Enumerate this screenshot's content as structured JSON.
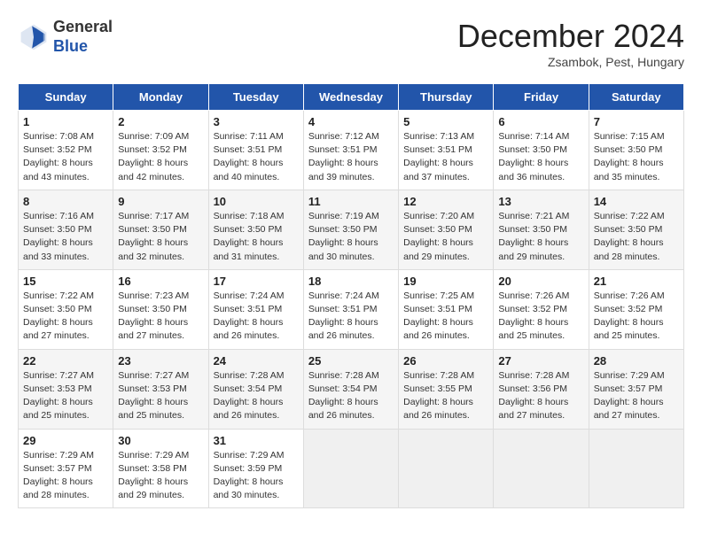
{
  "header": {
    "logo": {
      "line1": "General",
      "line2": "Blue"
    },
    "month": "December 2024",
    "location": "Zsambok, Pest, Hungary"
  },
  "weekdays": [
    "Sunday",
    "Monday",
    "Tuesday",
    "Wednesday",
    "Thursday",
    "Friday",
    "Saturday"
  ],
  "weeks": [
    [
      {
        "day": "1",
        "info": "Sunrise: 7:08 AM\nSunset: 3:52 PM\nDaylight: 8 hours\nand 43 minutes."
      },
      {
        "day": "2",
        "info": "Sunrise: 7:09 AM\nSunset: 3:52 PM\nDaylight: 8 hours\nand 42 minutes."
      },
      {
        "day": "3",
        "info": "Sunrise: 7:11 AM\nSunset: 3:51 PM\nDaylight: 8 hours\nand 40 minutes."
      },
      {
        "day": "4",
        "info": "Sunrise: 7:12 AM\nSunset: 3:51 PM\nDaylight: 8 hours\nand 39 minutes."
      },
      {
        "day": "5",
        "info": "Sunrise: 7:13 AM\nSunset: 3:51 PM\nDaylight: 8 hours\nand 37 minutes."
      },
      {
        "day": "6",
        "info": "Sunrise: 7:14 AM\nSunset: 3:50 PM\nDaylight: 8 hours\nand 36 minutes."
      },
      {
        "day": "7",
        "info": "Sunrise: 7:15 AM\nSunset: 3:50 PM\nDaylight: 8 hours\nand 35 minutes."
      }
    ],
    [
      {
        "day": "8",
        "info": "Sunrise: 7:16 AM\nSunset: 3:50 PM\nDaylight: 8 hours\nand 33 minutes."
      },
      {
        "day": "9",
        "info": "Sunrise: 7:17 AM\nSunset: 3:50 PM\nDaylight: 8 hours\nand 32 minutes."
      },
      {
        "day": "10",
        "info": "Sunrise: 7:18 AM\nSunset: 3:50 PM\nDaylight: 8 hours\nand 31 minutes."
      },
      {
        "day": "11",
        "info": "Sunrise: 7:19 AM\nSunset: 3:50 PM\nDaylight: 8 hours\nand 30 minutes."
      },
      {
        "day": "12",
        "info": "Sunrise: 7:20 AM\nSunset: 3:50 PM\nDaylight: 8 hours\nand 29 minutes."
      },
      {
        "day": "13",
        "info": "Sunrise: 7:21 AM\nSunset: 3:50 PM\nDaylight: 8 hours\nand 29 minutes."
      },
      {
        "day": "14",
        "info": "Sunrise: 7:22 AM\nSunset: 3:50 PM\nDaylight: 8 hours\nand 28 minutes."
      }
    ],
    [
      {
        "day": "15",
        "info": "Sunrise: 7:22 AM\nSunset: 3:50 PM\nDaylight: 8 hours\nand 27 minutes."
      },
      {
        "day": "16",
        "info": "Sunrise: 7:23 AM\nSunset: 3:50 PM\nDaylight: 8 hours\nand 27 minutes."
      },
      {
        "day": "17",
        "info": "Sunrise: 7:24 AM\nSunset: 3:51 PM\nDaylight: 8 hours\nand 26 minutes."
      },
      {
        "day": "18",
        "info": "Sunrise: 7:24 AM\nSunset: 3:51 PM\nDaylight: 8 hours\nand 26 minutes."
      },
      {
        "day": "19",
        "info": "Sunrise: 7:25 AM\nSunset: 3:51 PM\nDaylight: 8 hours\nand 26 minutes."
      },
      {
        "day": "20",
        "info": "Sunrise: 7:26 AM\nSunset: 3:52 PM\nDaylight: 8 hours\nand 25 minutes."
      },
      {
        "day": "21",
        "info": "Sunrise: 7:26 AM\nSunset: 3:52 PM\nDaylight: 8 hours\nand 25 minutes."
      }
    ],
    [
      {
        "day": "22",
        "info": "Sunrise: 7:27 AM\nSunset: 3:53 PM\nDaylight: 8 hours\nand 25 minutes."
      },
      {
        "day": "23",
        "info": "Sunrise: 7:27 AM\nSunset: 3:53 PM\nDaylight: 8 hours\nand 25 minutes."
      },
      {
        "day": "24",
        "info": "Sunrise: 7:28 AM\nSunset: 3:54 PM\nDaylight: 8 hours\nand 26 minutes."
      },
      {
        "day": "25",
        "info": "Sunrise: 7:28 AM\nSunset: 3:54 PM\nDaylight: 8 hours\nand 26 minutes."
      },
      {
        "day": "26",
        "info": "Sunrise: 7:28 AM\nSunset: 3:55 PM\nDaylight: 8 hours\nand 26 minutes."
      },
      {
        "day": "27",
        "info": "Sunrise: 7:28 AM\nSunset: 3:56 PM\nDaylight: 8 hours\nand 27 minutes."
      },
      {
        "day": "28",
        "info": "Sunrise: 7:29 AM\nSunset: 3:57 PM\nDaylight: 8 hours\nand 27 minutes."
      }
    ],
    [
      {
        "day": "29",
        "info": "Sunrise: 7:29 AM\nSunset: 3:57 PM\nDaylight: 8 hours\nand 28 minutes."
      },
      {
        "day": "30",
        "info": "Sunrise: 7:29 AM\nSunset: 3:58 PM\nDaylight: 8 hours\nand 29 minutes."
      },
      {
        "day": "31",
        "info": "Sunrise: 7:29 AM\nSunset: 3:59 PM\nDaylight: 8 hours\nand 30 minutes."
      },
      {
        "day": "",
        "info": ""
      },
      {
        "day": "",
        "info": ""
      },
      {
        "day": "",
        "info": ""
      },
      {
        "day": "",
        "info": ""
      }
    ]
  ]
}
